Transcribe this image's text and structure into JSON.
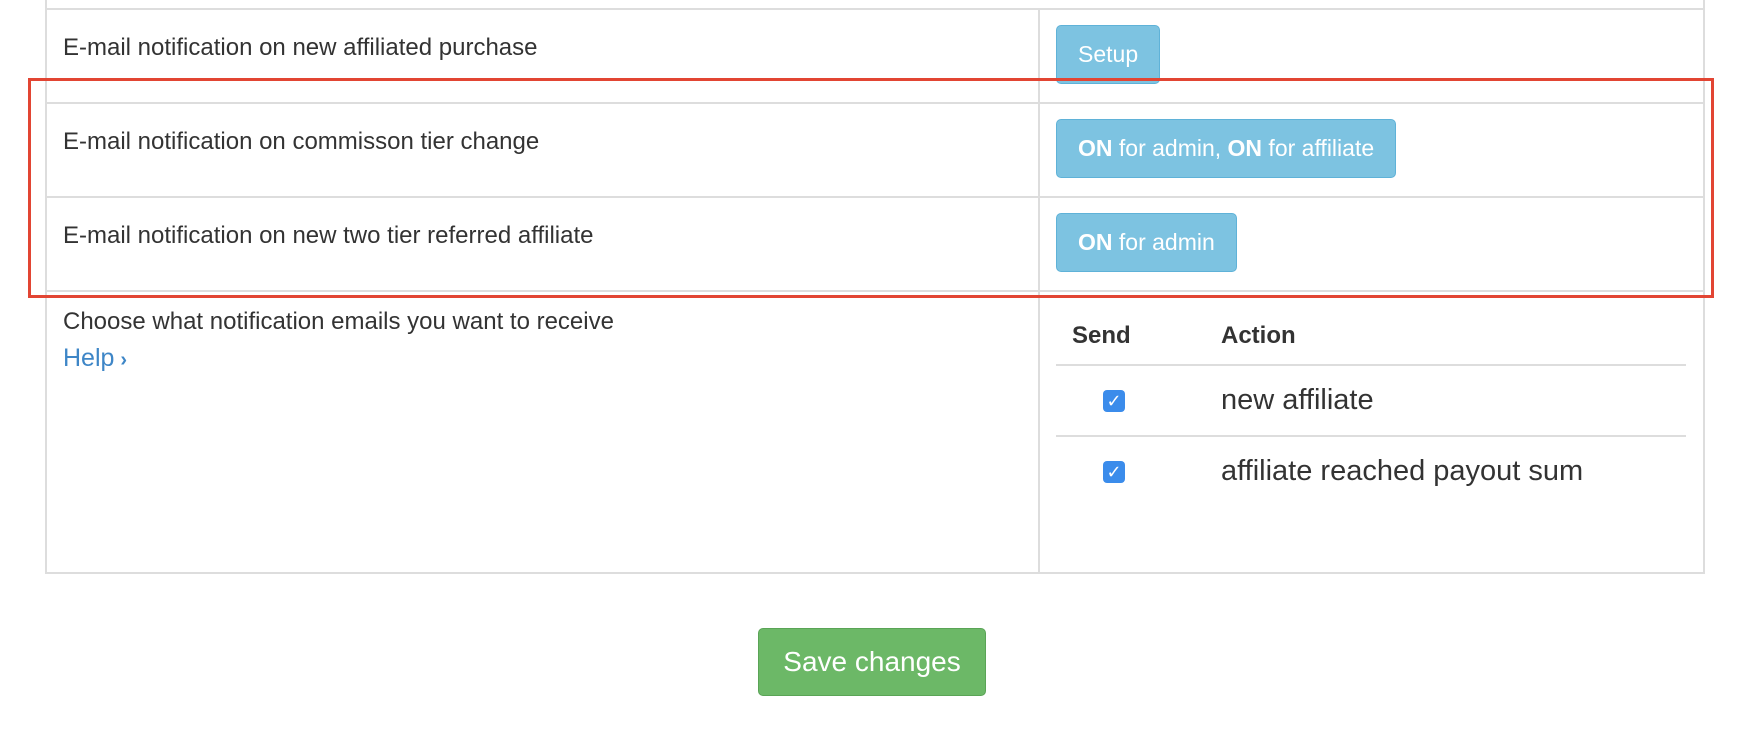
{
  "rows": [
    {
      "label": "E-mail notification on new affiliated purchase",
      "button": "Setup"
    },
    {
      "label": "E-mail notification on commisson tier change",
      "button_parts": [
        "ON",
        " for admin, ",
        "ON",
        " for affiliate"
      ]
    },
    {
      "label": "E-mail notification on new two tier referred affiliate",
      "button_parts": [
        "ON",
        " for admin"
      ]
    }
  ],
  "notifications": {
    "label": "Choose what notification emails you want to receive",
    "help": "Help",
    "headers": {
      "send": "Send",
      "action": "Action"
    },
    "items": [
      {
        "checked": true,
        "action": "new affiliate"
      },
      {
        "checked": true,
        "action": "affiliate reached payout sum"
      }
    ]
  },
  "save_label": "Save changes",
  "colors": {
    "info_button": "#7dc3e1",
    "save_button": "#6cb867",
    "highlight": "#e24533",
    "link": "#3e86c7",
    "checkbox": "#3b8ceb"
  }
}
